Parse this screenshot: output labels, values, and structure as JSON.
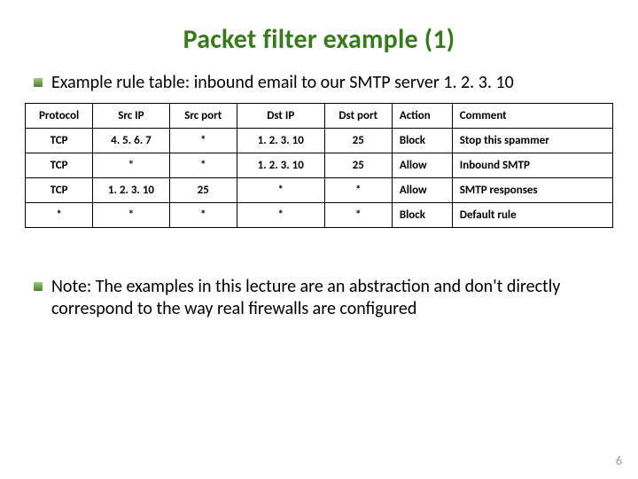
{
  "title": "Packet filter example (1)",
  "intro": "Example rule table: inbound email to our SMTP server 1. 2. 3. 10",
  "columns": {
    "protocol": "Protocol",
    "src_ip": "Src IP",
    "src_port": "Src port",
    "dst_ip": "Dst IP",
    "dst_port": "Dst port",
    "action": "Action",
    "comment": "Comment"
  },
  "rules": [
    {
      "protocol": "TCP",
      "src_ip": "4. 5. 6. 7",
      "src_port": "*",
      "dst_ip": "1. 2. 3. 10",
      "dst_port": "25",
      "action": "Block",
      "comment": "Stop this spammer"
    },
    {
      "protocol": "TCP",
      "src_ip": "*",
      "src_port": "*",
      "dst_ip": "1. 2. 3. 10",
      "dst_port": "25",
      "action": "Allow",
      "comment": "Inbound SMTP"
    },
    {
      "protocol": "TCP",
      "src_ip": "1. 2. 3. 10",
      "src_port": "25",
      "dst_ip": "*",
      "dst_port": "*",
      "action": "Allow",
      "comment": "SMTP responses"
    },
    {
      "protocol": "*",
      "src_ip": "*",
      "src_port": "*",
      "dst_ip": "*",
      "dst_port": "*",
      "action": "Block",
      "comment": "Default rule"
    }
  ],
  "note": "Note: The examples in this lecture are an abstraction and don't directly correspond to the way real firewalls are configured",
  "page_number": "6",
  "chart_data": {
    "type": "table",
    "title": "Packet filter example (1)",
    "columns": [
      "Protocol",
      "Src IP",
      "Src port",
      "Dst IP",
      "Dst port",
      "Action",
      "Comment"
    ],
    "rows": [
      [
        "TCP",
        "4. 5. 6. 7",
        "*",
        "1. 2. 3. 10",
        "25",
        "Block",
        "Stop this spammer"
      ],
      [
        "TCP",
        "*",
        "*",
        "1. 2. 3. 10",
        "25",
        "Allow",
        "Inbound SMTP"
      ],
      [
        "TCP",
        "1. 2. 3. 10",
        "25",
        "*",
        "*",
        "Allow",
        "SMTP responses"
      ],
      [
        "*",
        "*",
        "*",
        "*",
        "*",
        "Block",
        "Default rule"
      ]
    ]
  }
}
